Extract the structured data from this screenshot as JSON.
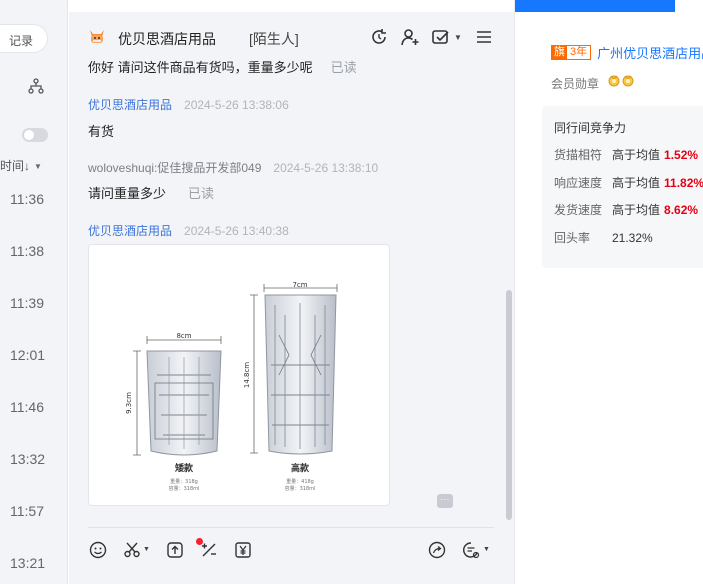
{
  "left_panel": {
    "search_label": "记录",
    "sort_label": "时间↓",
    "times": [
      "11:36",
      "11:38",
      "11:39",
      "12:01",
      "11:46",
      "13:32",
      "11:57",
      "13:21"
    ]
  },
  "chat": {
    "shop_name": "优贝思酒店用品",
    "relation_tag": "[陌生人]",
    "messages": [
      {
        "kind": "text",
        "text": "你好 请问这件商品有货吗，重量多少呢",
        "read": "已读"
      },
      {
        "kind": "sender",
        "name": "优贝思酒店用品",
        "time": "2024-5-26 13:38:06"
      },
      {
        "kind": "text",
        "text": "有货"
      },
      {
        "kind": "sender",
        "name": "woloveshuqi:促佳搜品开发部049",
        "time": "2024-5-26 13:38:10"
      },
      {
        "kind": "text",
        "text": "请问重量多少",
        "read": "已读"
      },
      {
        "kind": "sender",
        "name": "优贝思酒店用品",
        "time": "2024-5-26 13:40:38"
      }
    ],
    "product_image": {
      "short_glass": {
        "width": "8cm",
        "height": "9.3cm",
        "name": "矮款",
        "weight": "重量：318g",
        "capacity": "容量：318ml"
      },
      "tall_glass": {
        "width": "7cm",
        "height": "14.8cm",
        "name": "高款",
        "weight": "重量：418g",
        "capacity": "容量：318ml"
      }
    },
    "more_glyph": "···"
  },
  "right_panel": {
    "years_icon": "旗",
    "years": "3年",
    "company_name": "广州优贝思酒店用品",
    "medal_label": "会员勋章",
    "competition": {
      "title": "同行间竞争力",
      "rows": [
        {
          "label": "货描相符",
          "compare": "高于均值",
          "value": "1.52%"
        },
        {
          "label": "响应速度",
          "compare": "高于均值",
          "value": "11.82%"
        },
        {
          "label": "发货速度",
          "compare": "高于均值",
          "value": "8.62%"
        },
        {
          "label": "回头率",
          "compare": "",
          "value": "21.32%"
        }
      ]
    }
  },
  "colors": {
    "accent": "#1677ff",
    "link": "#3b74d9",
    "highlight": "#e60012",
    "badge": "#ff6a00"
  }
}
